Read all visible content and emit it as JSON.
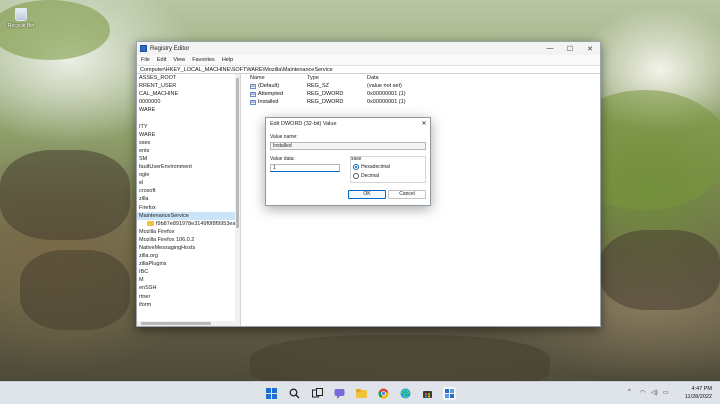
{
  "desktop": {
    "icons": [
      {
        "label": "Recycle Bin",
        "icon": "recycle-bin-icon"
      }
    ]
  },
  "window": {
    "title": "Registry Editor",
    "menu": [
      "File",
      "Edit",
      "View",
      "Favorites",
      "Help"
    ],
    "address": "Computer\\HKEY_LOCAL_MACHINE\\SOFTWARE\\Mozilla\\MaintenanceService",
    "controls": {
      "minimize": "—",
      "maximize": "☐",
      "close": "✕"
    }
  },
  "tree": {
    "items": [
      {
        "label": "ASSES_ROOT"
      },
      {
        "label": "RRENT_USER"
      },
      {
        "label": "CAL_MACHINE"
      },
      {
        "label": "0000000"
      },
      {
        "label": "WARE"
      },
      {
        "label": ""
      },
      {
        "label": "ITY"
      },
      {
        "label": "WARE"
      },
      {
        "label": "sses"
      },
      {
        "label": "ents"
      },
      {
        "label": "SM"
      },
      {
        "label": "faultUserEnvironment"
      },
      {
        "label": "ogle"
      },
      {
        "label": "el"
      },
      {
        "label": "crosoft"
      },
      {
        "label": "zilla"
      },
      {
        "label": "Firefox"
      },
      {
        "label": "MaintenanceService",
        "selected": true
      },
      {
        "label": "f9b87e891978e3149f0f8f9953eadcl",
        "child": true
      },
      {
        "label": "Mozilla Firefox"
      },
      {
        "label": "Mozilla Firefox 106.0.2"
      },
      {
        "label": "NativeMessagingHosts"
      },
      {
        "label": "zilla.org"
      },
      {
        "label": "zillaPlugins"
      },
      {
        "label": "IBC"
      },
      {
        "label": "M"
      },
      {
        "label": "enSSH"
      },
      {
        "label": "rtner"
      },
      {
        "label": "iform"
      }
    ]
  },
  "values": {
    "headers": {
      "name": "Name",
      "type": "Type",
      "data": "Data"
    },
    "rows": [
      {
        "icon": "ab",
        "name": "(Default)",
        "type": "REG_SZ",
        "data": "(value not set)"
      },
      {
        "icon": "011",
        "name": "Attempted",
        "type": "REG_DWORD",
        "data": "0x00000001 (1)"
      },
      {
        "icon": "011",
        "name": "Installed",
        "type": "REG_DWORD",
        "data": "0x00000001 (1)"
      }
    ]
  },
  "dialog": {
    "title": "Edit DWORD (32-bit) Value",
    "close": "✕",
    "value_name_label": "Value name:",
    "value_name": "Installed",
    "value_data_label": "Value data:",
    "value_data": "1",
    "base_label": "Base",
    "radio_hex": "Hexadecimal",
    "radio_dec": "Decimal",
    "selected_base": "Hexadecimal",
    "ok": "OK",
    "cancel": "Cancel"
  },
  "taskbar": {
    "icons": [
      "windows-start-icon",
      "search-icon",
      "task-view-icon",
      "chat-icon",
      "file-explorer-icon",
      "chrome-icon",
      "edge-icon",
      "store-icon",
      "registry-editor-icon"
    ],
    "tray": {
      "chevron": "^",
      "wifi": "◠",
      "volume": "◁)",
      "battery": "▭"
    },
    "time": "4:47 PM",
    "date": "11/28/2022"
  },
  "colors": {
    "accent": "#0067c0",
    "selection": "#cce4f7",
    "taskbar": "#dfe4ea"
  }
}
